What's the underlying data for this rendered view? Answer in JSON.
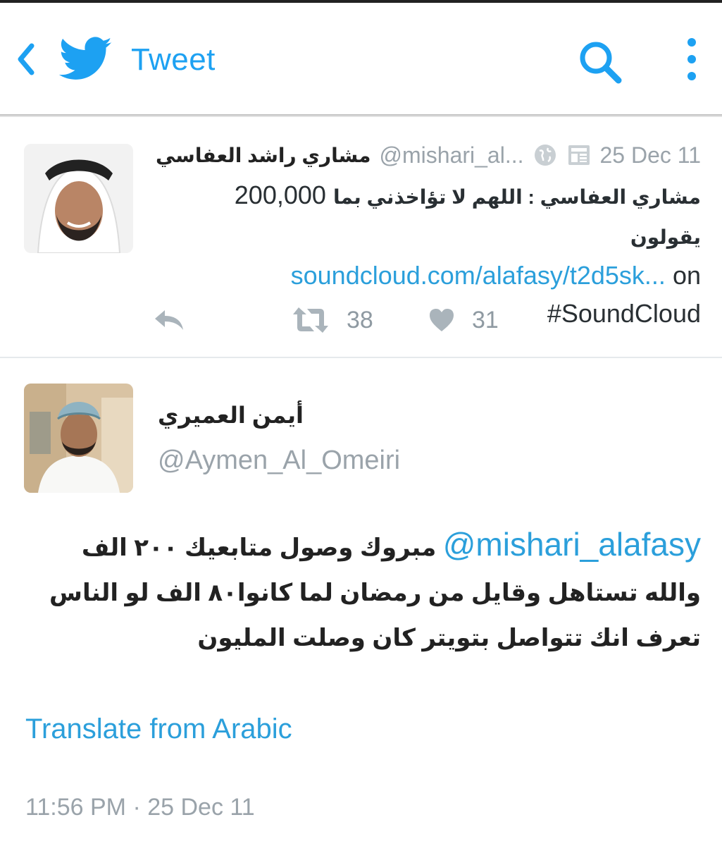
{
  "header": {
    "title": "Tweet",
    "accent_color": "#1da1f2",
    "icons": [
      "back-chevron-icon",
      "twitter-bird-icon",
      "search-icon",
      "more-vertical-icon"
    ]
  },
  "embedded_tweet": {
    "author_name": "مشاري راشد العفاسي",
    "handle": "@mishari_al...",
    "date": "25 Dec 11",
    "text_number": "200,000",
    "text_arabic": "مشاري العفاسي : اللهم لا تؤاخذني بما يقولون",
    "link": "soundcloud.com/alafasy/t2d5sk...",
    "link_suffix": "on",
    "hashtag": "#SoundCloud",
    "retweets": "38",
    "likes": "31"
  },
  "main_tweet": {
    "author_name": "أيمن العميري",
    "handle": "@Aymen_Al_Omeiri",
    "mention": "@mishari_alafasy",
    "line1": "مبروك وصول متابعيك ٢٠٠ الف",
    "line2": "والله تستاهل وقايل من رمضان لما كانوا٨٠ الف لو الناس",
    "line3": "تعرف انك تتواصل بتويتر كان وصلت المليون",
    "translate_label": "Translate from Arabic",
    "timestamp": "11:56 PM · 25 Dec 11"
  }
}
